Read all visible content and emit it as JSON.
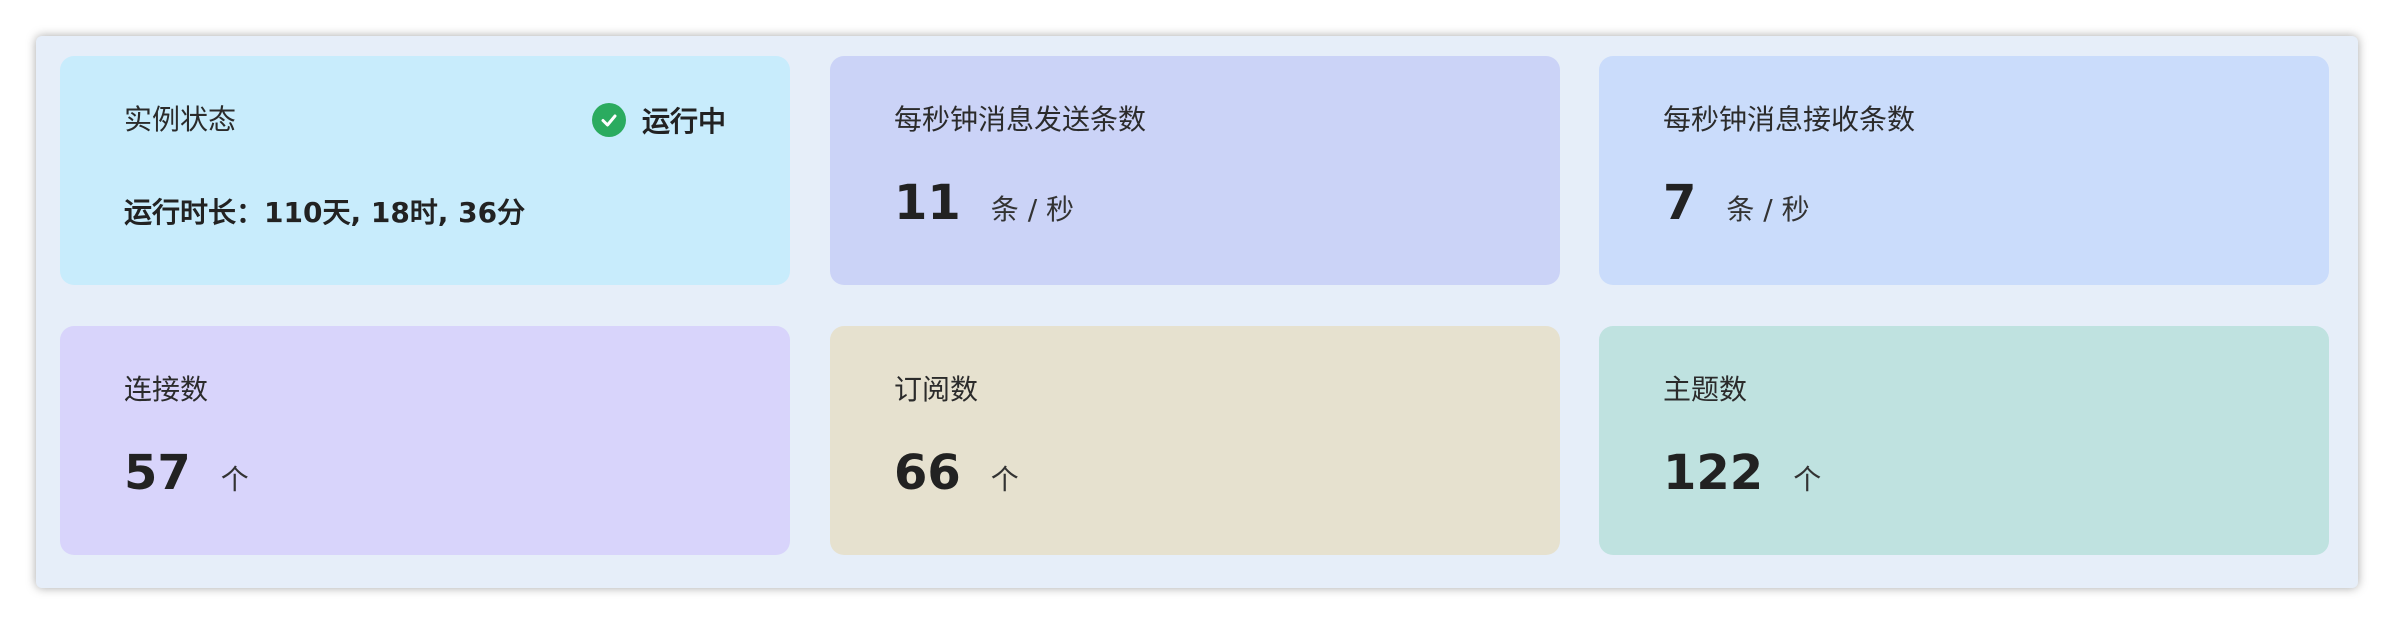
{
  "colors": {
    "instance_card": "#c8ecfc",
    "send_card": "#cbd3f7",
    "receive_card": "#cadcfb",
    "connections_card": "#d8d4fb",
    "subscriptions_card": "#e6e1cf",
    "topics_card": "#bfe2e0",
    "status_ok": "#2bab5f"
  },
  "instance": {
    "label": "实例状态",
    "status_icon": "check-circle-icon",
    "status_text": "运行中",
    "uptime": "运行时长：110天, 18时, 36分"
  },
  "send_rate": {
    "label": "每秒钟消息发送条数",
    "value": "11",
    "unit": "条 / 秒"
  },
  "receive_rate": {
    "label": "每秒钟消息接收条数",
    "value": "7",
    "unit": "条 / 秒"
  },
  "connections": {
    "label": "连接数",
    "value": "57",
    "unit": "个"
  },
  "subscriptions": {
    "label": "订阅数",
    "value": "66",
    "unit": "个"
  },
  "topics": {
    "label": "主题数",
    "value": "122",
    "unit": "个"
  }
}
